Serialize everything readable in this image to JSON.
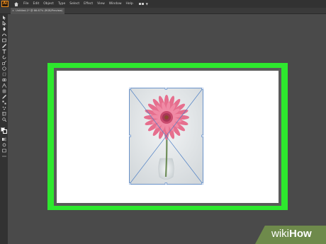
{
  "app": {
    "logo_text": "Ai"
  },
  "menubar": {
    "items": [
      "File",
      "Edit",
      "Object",
      "Type",
      "Select",
      "Effect",
      "View",
      "Window",
      "Help"
    ]
  },
  "document": {
    "tab_title": "Untitled-1* @ 66.67% (RGB/Preview)",
    "close_glyph": "×"
  },
  "canvas": {
    "highlight_color": "#2ee82e",
    "artboard_color": "#ffffff"
  },
  "placed_image": {
    "subject": "pink gerbera daisy in glass vase"
  },
  "watermark": {
    "part1": "wiki",
    "part2": "How"
  }
}
